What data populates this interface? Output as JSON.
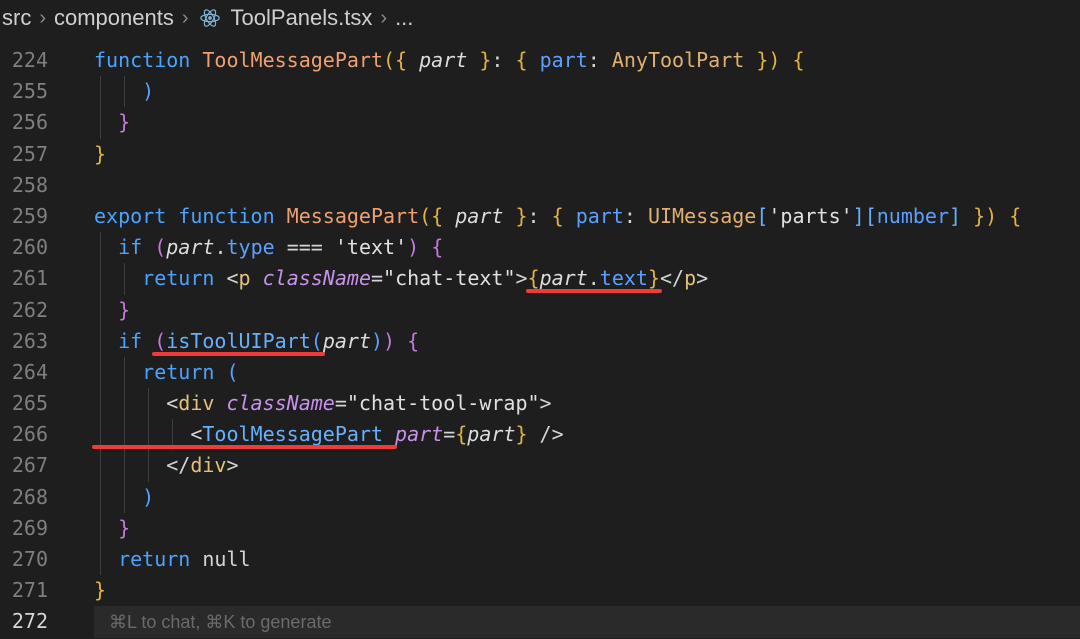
{
  "breadcrumb": {
    "items": [
      "src",
      "components",
      "ToolPanels.tsx",
      "..."
    ]
  },
  "editor": {
    "lines": [
      {
        "n": "224",
        "tokens": [
          [
            "k",
            "function "
          ],
          [
            "fn",
            "ToolMessagePart"
          ],
          [
            "p",
            "({ "
          ],
          [
            "par",
            "part"
          ],
          [
            "wh",
            " "
          ],
          [
            "p",
            "}"
          ],
          [
            "wh",
            ": "
          ],
          [
            "p",
            "{ "
          ],
          [
            "k2",
            "part"
          ],
          [
            "wh",
            ": "
          ],
          [
            "ty",
            "AnyToolPart "
          ],
          [
            "p",
            "}) {"
          ]
        ]
      },
      {
        "n": "255",
        "tokens": [
          [
            "wh",
            "    "
          ],
          [
            "k2",
            ")"
          ]
        ]
      },
      {
        "n": "256",
        "tokens": [
          [
            "wh",
            "  "
          ],
          [
            "pm",
            "}"
          ]
        ]
      },
      {
        "n": "257",
        "tokens": [
          [
            "p",
            "}"
          ]
        ]
      },
      {
        "n": "258",
        "tokens": []
      },
      {
        "n": "259",
        "tokens": [
          [
            "k",
            "export function "
          ],
          [
            "fn",
            "MessagePart"
          ],
          [
            "p",
            "({ "
          ],
          [
            "par",
            "part"
          ],
          [
            "wh",
            " "
          ],
          [
            "p",
            "}"
          ],
          [
            "wh",
            ": "
          ],
          [
            "p",
            "{ "
          ],
          [
            "k2",
            "part"
          ],
          [
            "wh",
            ": "
          ],
          [
            "ty",
            "UIMessage"
          ],
          [
            "jsx",
            "["
          ],
          [
            "str",
            "'parts'"
          ],
          [
            "jsx",
            "]["
          ],
          [
            "k2",
            "number"
          ],
          [
            "jsx",
            "] "
          ],
          [
            "p",
            "}) {"
          ]
        ]
      },
      {
        "n": "260",
        "tokens": [
          [
            "wh",
            "  "
          ],
          [
            "k",
            "if "
          ],
          [
            "pm",
            "("
          ],
          [
            "par",
            "part"
          ],
          [
            "wh",
            "."
          ],
          [
            "k2",
            "type"
          ],
          [
            "wh",
            " === "
          ],
          [
            "str",
            "'text'"
          ],
          [
            "pm",
            ")"
          ],
          [
            "wh",
            " "
          ],
          [
            "pm",
            "{"
          ]
        ]
      },
      {
        "n": "261",
        "tokens": [
          [
            "wh",
            "    "
          ],
          [
            "k",
            "return "
          ],
          [
            "wh",
            "<"
          ],
          [
            "tag",
            "p "
          ],
          [
            "attr",
            "className"
          ],
          [
            "wh",
            "="
          ],
          [
            "str",
            "\"chat-text\""
          ],
          [
            "wh",
            ">"
          ],
          [
            "p",
            "{"
          ],
          [
            "par",
            "part"
          ],
          [
            "wh",
            "."
          ],
          [
            "k2",
            "text"
          ],
          [
            "p",
            "}"
          ],
          [
            "wh",
            "</"
          ],
          [
            "tag",
            "p"
          ],
          [
            "wh",
            ">"
          ]
        ]
      },
      {
        "n": "262",
        "tokens": [
          [
            "wh",
            "  "
          ],
          [
            "pm",
            "}"
          ]
        ]
      },
      {
        "n": "263",
        "tokens": [
          [
            "wh",
            "  "
          ],
          [
            "k",
            "if "
          ],
          [
            "pm",
            "("
          ],
          [
            "jsx",
            "isToolUIPart"
          ],
          [
            "k2",
            "("
          ],
          [
            "par",
            "part"
          ],
          [
            "k2",
            ")"
          ],
          [
            "pm",
            ")"
          ],
          [
            "wh",
            " "
          ],
          [
            "pm",
            "{"
          ]
        ]
      },
      {
        "n": "264",
        "tokens": [
          [
            "wh",
            "    "
          ],
          [
            "k",
            "return "
          ],
          [
            "k2",
            "("
          ]
        ]
      },
      {
        "n": "265",
        "tokens": [
          [
            "wh",
            "      <"
          ],
          [
            "tag",
            "div "
          ],
          [
            "attr",
            "className"
          ],
          [
            "wh",
            "="
          ],
          [
            "str",
            "\"chat-tool-wrap\""
          ],
          [
            "wh",
            ">"
          ]
        ]
      },
      {
        "n": "266",
        "tokens": [
          [
            "wh",
            "        <"
          ],
          [
            "jsx",
            "ToolMessagePart "
          ],
          [
            "attr",
            "part"
          ],
          [
            "wh",
            "="
          ],
          [
            "p",
            "{"
          ],
          [
            "par",
            "part"
          ],
          [
            "p",
            "}"
          ],
          [
            "wh",
            " />"
          ]
        ]
      },
      {
        "n": "267",
        "tokens": [
          [
            "wh",
            "      </"
          ],
          [
            "tag",
            "div"
          ],
          [
            "wh",
            ">"
          ]
        ]
      },
      {
        "n": "268",
        "tokens": [
          [
            "wh",
            "    "
          ],
          [
            "k2",
            ")"
          ]
        ]
      },
      {
        "n": "269",
        "tokens": [
          [
            "wh",
            "  "
          ],
          [
            "pm",
            "}"
          ]
        ]
      },
      {
        "n": "270",
        "tokens": [
          [
            "wh",
            "  "
          ],
          [
            "k",
            "return "
          ],
          [
            "wh",
            "null"
          ]
        ]
      },
      {
        "n": "271",
        "tokens": [
          [
            "p",
            "}"
          ]
        ]
      },
      {
        "n": "272",
        "tokens": []
      }
    ],
    "ghost_hint": "⌘L to chat, ⌘K to generate"
  },
  "colors": {
    "background": "#1e1e1e",
    "underline": "#ef3b3b"
  }
}
